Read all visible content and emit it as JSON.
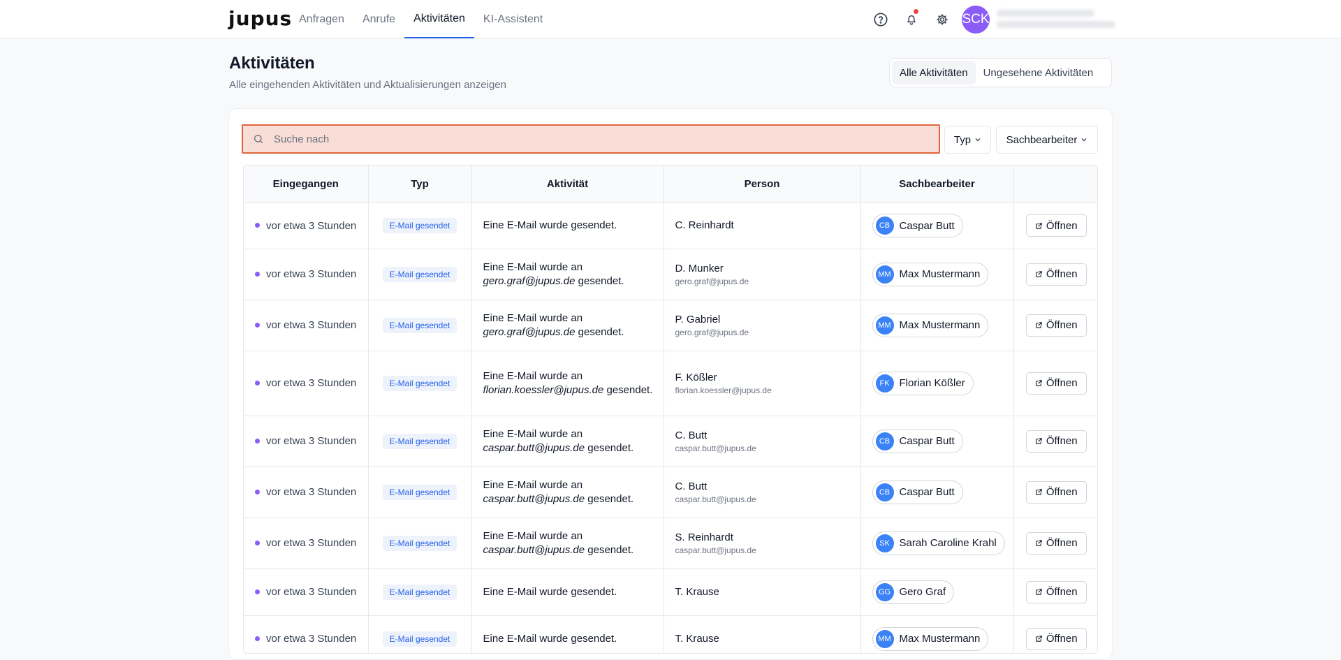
{
  "app": {
    "logo": "jupus"
  },
  "nav": [
    {
      "label": "Anfragen",
      "active": false
    },
    {
      "label": "Anrufe",
      "active": false
    },
    {
      "label": "Aktivitäten",
      "active": true
    },
    {
      "label": "KI-Assistent",
      "active": false
    }
  ],
  "topbar": {
    "avatar_initials": "SCK",
    "icons": [
      "help-icon",
      "bell-icon",
      "gear-icon"
    ]
  },
  "header": {
    "title": "Aktivitäten",
    "subtitle": "Alle eingehenden Aktivitäten und Aktualisierungen anzeigen",
    "tabs": [
      {
        "label": "Alle Aktivitäten",
        "active": true
      },
      {
        "label": "Ungesehene Aktivitäten",
        "active": false
      }
    ]
  },
  "search": {
    "placeholder": "Suche nach"
  },
  "filters": {
    "type_label": "Typ",
    "agent_label": "Sachbearbeiter"
  },
  "table": {
    "columns": [
      "Eingegangen",
      "Typ",
      "Aktivität",
      "Person",
      "Sachbearbeiter",
      ""
    ],
    "open_label": "Öffnen",
    "rows": [
      {
        "time": "vor etwa 3 Stunden",
        "type": "E-Mail gesendet",
        "act_pre": "Eine E-Mail wurde gesendet.",
        "act_mail": "",
        "act_post": "",
        "name": "C. Reinhardt",
        "email": "",
        "agent_initials": "CB",
        "agent": "Caspar Butt"
      },
      {
        "time": "vor etwa 3 Stunden",
        "type": "E-Mail gesendet",
        "act_pre": "Eine E-Mail wurde an",
        "act_mail": "gero.graf@jupus.de",
        "act_post": "gesendet.",
        "name": "D. Munker",
        "email": "gero.graf@jupus.de",
        "agent_initials": "MM",
        "agent": "Max Mustermann"
      },
      {
        "time": "vor etwa 3 Stunden",
        "type": "E-Mail gesendet",
        "act_pre": "Eine E-Mail wurde an",
        "act_mail": "gero.graf@jupus.de",
        "act_post": "gesendet.",
        "name": "P. Gabriel",
        "email": "gero.graf@jupus.de",
        "agent_initials": "MM",
        "agent": "Max Mustermann"
      },
      {
        "time": "vor etwa 3 Stunden",
        "type": "E-Mail gesendet",
        "act_pre": "Eine E-Mail wurde an",
        "act_mail": "florian.koessler@jupus.de",
        "act_post": "gesendet.",
        "name": "F. Kößler",
        "email": "florian.koessler@jupus.de",
        "agent_initials": "FK",
        "agent": "Florian Kößler"
      },
      {
        "time": "vor etwa 3 Stunden",
        "type": "E-Mail gesendet",
        "act_pre": "Eine E-Mail wurde an",
        "act_mail": "caspar.butt@jupus.de",
        "act_post": "gesendet.",
        "name": "C. Butt",
        "email": "caspar.butt@jupus.de",
        "agent_initials": "CB",
        "agent": "Caspar Butt"
      },
      {
        "time": "vor etwa 3 Stunden",
        "type": "E-Mail gesendet",
        "act_pre": "Eine E-Mail wurde an",
        "act_mail": "caspar.butt@jupus.de",
        "act_post": "gesendet.",
        "name": "C. Butt",
        "email": "caspar.butt@jupus.de",
        "agent_initials": "CB",
        "agent": "Caspar Butt"
      },
      {
        "time": "vor etwa 3 Stunden",
        "type": "E-Mail gesendet",
        "act_pre": "Eine E-Mail wurde an",
        "act_mail": "caspar.butt@jupus.de",
        "act_post": "gesendet.",
        "name": "S. Reinhardt",
        "email": "caspar.butt@jupus.de",
        "agent_initials": "SK",
        "agent": "Sarah Caroline Krahl"
      },
      {
        "time": "vor etwa 3 Stunden",
        "type": "E-Mail gesendet",
        "act_pre": "Eine E-Mail wurde gesendet.",
        "act_mail": "",
        "act_post": "",
        "name": "T. Krause",
        "email": "",
        "agent_initials": "GG",
        "agent": "Gero Graf"
      },
      {
        "time": "vor etwa 3 Stunden",
        "type": "E-Mail gesendet",
        "act_pre": "Eine E-Mail wurde gesendet.",
        "act_mail": "",
        "act_post": "",
        "name": "T. Krause",
        "email": "",
        "agent_initials": "MM",
        "agent": "Max Mustermann"
      }
    ]
  }
}
